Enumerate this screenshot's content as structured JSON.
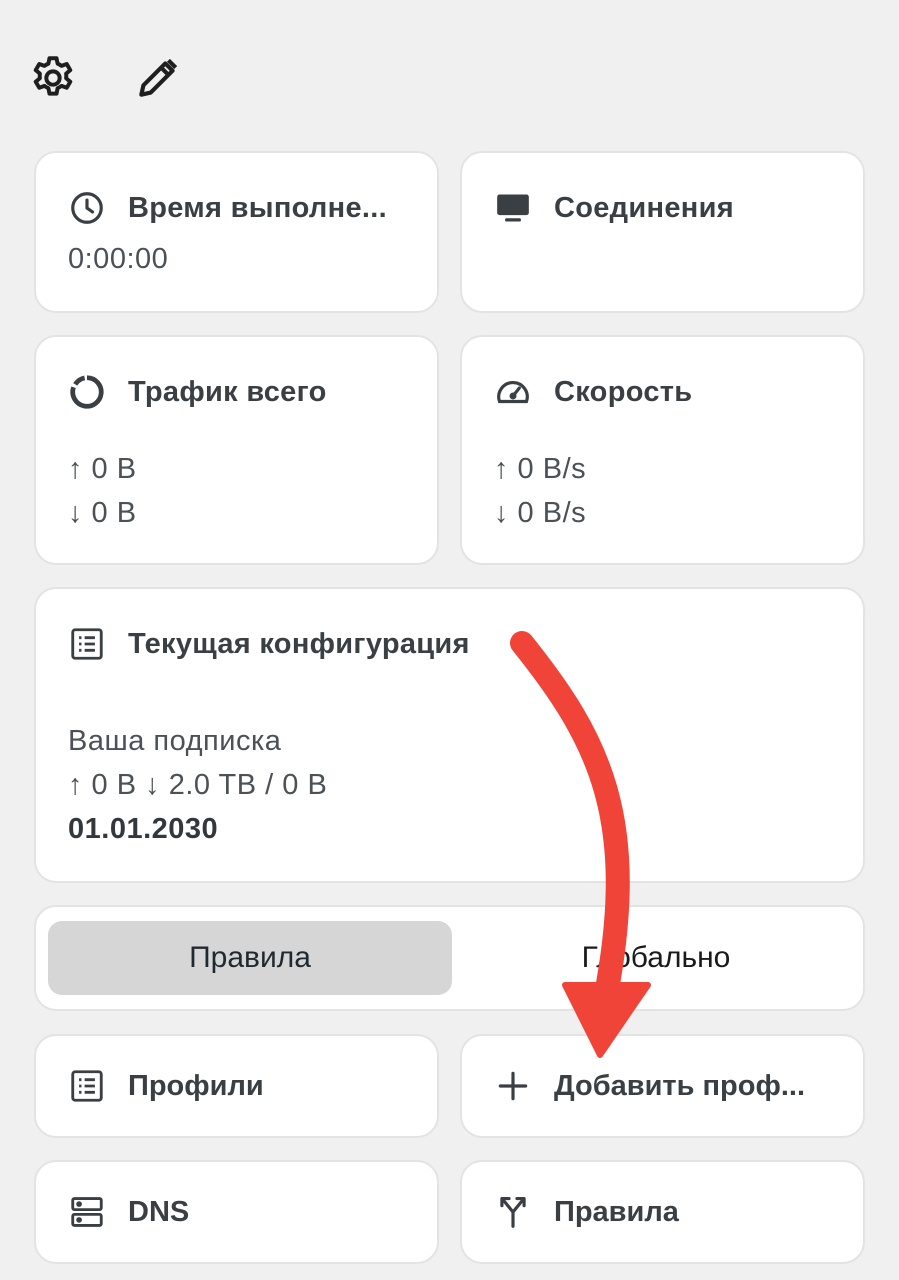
{
  "toolbar": {
    "settings_icon": "gear-icon",
    "edit_icon": "pencil-icon"
  },
  "cards": {
    "runtime": {
      "title": "Время выполне...",
      "value": "0:00:00",
      "icon": "clock-icon"
    },
    "connections": {
      "title": "Соединения",
      "icon": "monitor-icon"
    },
    "traffic": {
      "title": "Трафик всего",
      "up": "↑ 0 B",
      "down": "↓ 0 B",
      "icon": "donut-icon"
    },
    "speed": {
      "title": "Скорость",
      "up": "↑ 0 B/s",
      "down": "↓ 0 B/s",
      "icon": "speedometer-icon"
    },
    "config": {
      "title": "Текущая конфигурация",
      "subscription": "Ваша подписка",
      "usage": "↑ 0 B ↓ 2.0 TB / 0 B",
      "expires": "01.01.2030",
      "icon": "list-icon"
    }
  },
  "mode": {
    "options": [
      "Правила",
      "Глобально"
    ],
    "selected": "Правила"
  },
  "tiles": {
    "profiles": {
      "label": "Профили",
      "icon": "list-icon"
    },
    "add_profile": {
      "label": "Добавить проф...",
      "icon": "plus-icon"
    },
    "dns": {
      "label": "DNS",
      "icon": "server-icon"
    },
    "rules": {
      "label": "Правила",
      "icon": "fork-icon"
    }
  },
  "colors": {
    "background": "#f0f0f0",
    "card": "#ffffff",
    "segment_active": "#d6d6d6",
    "annotation_arrow": "#f04438"
  }
}
